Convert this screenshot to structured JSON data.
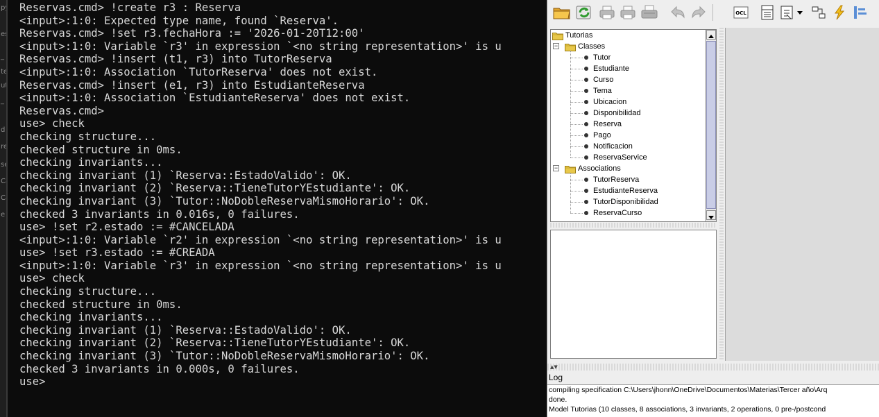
{
  "left_strip": {
    "fragments": [
      "py",
      "es",
      "_",
      "te",
      "ut",
      "_",
      "d",
      "re",
      "se",
      "Ca",
      "Ca",
      "e"
    ]
  },
  "terminal": {
    "lines": [
      "Reservas.cmd> !create r3 : Reserva",
      "<input>:1:0: Expected type name, found `Reserva'.",
      "Reservas.cmd> !set r3.fechaHora := '2026-01-20T12:00'",
      "<input>:1:0: Variable `r3' in expression `<no string representation>' is u",
      "Reservas.cmd> !insert (t1, r3) into TutorReserva",
      "<input>:1:0: Association `TutorReserva' does not exist.",
      "Reservas.cmd> !insert (e1, r3) into EstudianteReserva",
      "<input>:1:0: Association `EstudianteReserva' does not exist.",
      "Reservas.cmd>",
      "use> check",
      "checking structure...",
      "checked structure in 0ms.",
      "checking invariants...",
      "checking invariant (1) `Reserva::EstadoValido': OK.",
      "checking invariant (2) `Reserva::TieneTutorYEstudiante': OK.",
      "checking invariant (3) `Tutor::NoDobleReservaMismoHorario': OK.",
      "checked 3 invariants in 0.016s, 0 failures.",
      "use> !set r2.estado := #CANCELADA",
      "<input>:1:0: Variable `r2' in expression `<no string representation>' is u",
      "use> !set r3.estado := #CREADA",
      "<input>:1:0: Variable `r3' in expression `<no string representation>' is u",
      "use> check",
      "checking structure...",
      "checked structure in 0ms.",
      "checking invariants...",
      "checking invariant (1) `Reserva::EstadoValido': OK.",
      "checking invariant (2) `Reserva::TieneTutorYEstudiante': OK.",
      "checking invariant (3) `Tutor::NoDobleReservaMismoHorario': OK.",
      "checked 3 invariants in 0.000s, 0 failures.",
      "use>"
    ]
  },
  "toolbar": {
    "ocl_label": "OCL",
    "icons": [
      "open-folder-icon",
      "reload-icon",
      "print-icon",
      "print-view-icon",
      "print-alt-icon",
      "undo-icon",
      "redo-icon",
      "ocl-icon",
      "class-diagram-icon",
      "object-diagram-icon",
      "sequence-diagram-icon",
      "bolt-icon",
      "communication-diagram-icon"
    ]
  },
  "tree": {
    "root": "Tutorias",
    "classes_label": "Classes",
    "classes": [
      "Tutor",
      "Estudiante",
      "Curso",
      "Tema",
      "Ubicacion",
      "Disponibilidad",
      "Reserva",
      "Pago",
      "Notificacion",
      "ReservaService"
    ],
    "associations_label": "Associations",
    "associations": [
      "TutorReserva",
      "EstudianteReserva",
      "TutorDisponibilidad",
      "ReservaCurso"
    ]
  },
  "log": {
    "label": "Log",
    "lines": [
      "compiling specification C:\\Users\\jhonn\\OneDrive\\Documentos\\Materias\\Tercer año\\Arq",
      "done.",
      "Model Tutorias (10 classes, 8 associations, 3 invariants, 2 operations, 0 pre-/postcond"
    ]
  },
  "colors": {
    "terminal_bg": "#0c0c0c",
    "terminal_text": "#d8d8d8",
    "folder_yellow": "#e8c84a",
    "gui_bg": "#eeeeee"
  }
}
